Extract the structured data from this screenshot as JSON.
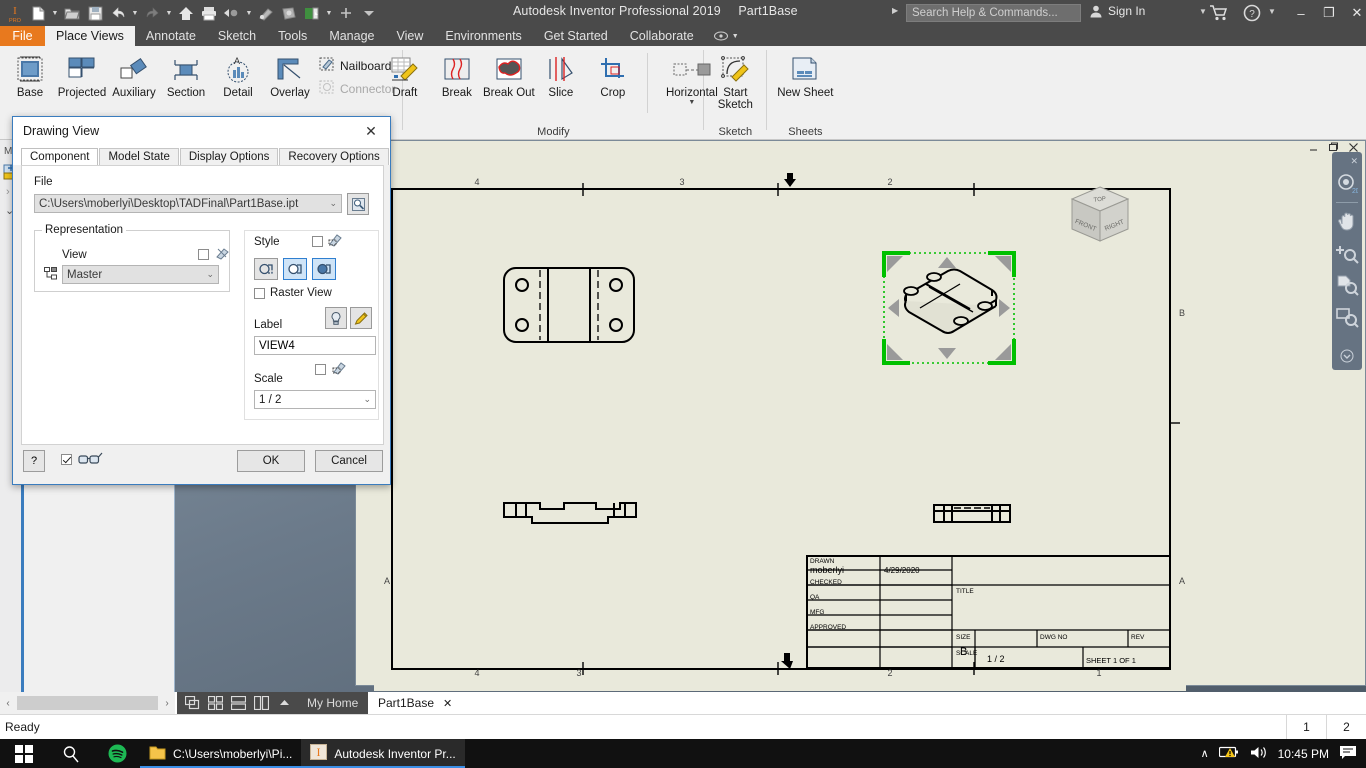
{
  "titlebar": {
    "app_title": "Autodesk Inventor Professional 2019",
    "document": "Part1Base",
    "search_placeholder": "Search Help & Commands...",
    "signin_label": "Sign In",
    "minimize": "–",
    "restore": "❐",
    "close": "✕",
    "quick_access": [
      {
        "name": "inventor-logo-icon",
        "label": "I"
      },
      {
        "name": "new-file-icon",
        "label": "New"
      },
      {
        "name": "open-file-icon",
        "label": "Open"
      },
      {
        "name": "save-icon",
        "label": "Save"
      },
      {
        "name": "undo-icon",
        "label": "Undo"
      },
      {
        "name": "redo-icon",
        "label": "Redo"
      },
      {
        "name": "home-icon",
        "label": "Home"
      },
      {
        "name": "print-icon",
        "label": "Print"
      },
      {
        "name": "select-icon",
        "label": "Select"
      },
      {
        "name": "appearance-icon",
        "label": "Appearance"
      },
      {
        "name": "material-icon",
        "label": "Material"
      },
      {
        "name": "project-icon",
        "label": "Project"
      },
      {
        "name": "add-icon",
        "label": "Add"
      },
      {
        "name": "customize-icon",
        "label": "Customize"
      }
    ]
  },
  "ribbon": {
    "file_tab": "File",
    "tabs": [
      {
        "label": "Place Views",
        "active": true
      },
      {
        "label": "Annotate",
        "active": false
      },
      {
        "label": "Sketch",
        "active": false
      },
      {
        "label": "Tools",
        "active": false
      },
      {
        "label": "Manage",
        "active": false
      },
      {
        "label": "View",
        "active": false
      },
      {
        "label": "Environments",
        "active": false
      },
      {
        "label": "Get Started",
        "active": false
      },
      {
        "label": "Collaborate",
        "active": false
      }
    ],
    "panels": [
      {
        "title": "",
        "buttons": [
          {
            "label": "Base",
            "icon": "base-view-icon"
          },
          {
            "label": "Projected",
            "icon": "projected-view-icon"
          },
          {
            "label": "Auxiliary",
            "icon": "auxiliary-view-icon"
          },
          {
            "label": "Section",
            "icon": "section-view-icon"
          },
          {
            "label": "Detail",
            "icon": "detail-view-icon"
          },
          {
            "label": "Overlay",
            "icon": "overlay-view-icon"
          }
        ],
        "small_buttons": [
          {
            "label": "Nailboard",
            "icon": "nailboard-icon",
            "disabled": false
          },
          {
            "label": "Connector",
            "icon": "connector-icon",
            "disabled": true
          }
        ]
      },
      {
        "title": "Modify",
        "buttons": [
          {
            "label": "Draft",
            "icon": "draft-icon"
          },
          {
            "label": "Break",
            "icon": "break-icon"
          },
          {
            "label": "Break Out",
            "icon": "break-out-icon"
          },
          {
            "label": "Slice",
            "icon": "slice-icon"
          },
          {
            "label": "Crop",
            "icon": "crop-icon"
          },
          {
            "label": "Horizontal",
            "icon": "horizontal-icon",
            "has_dropdown": true
          }
        ]
      },
      {
        "title": "Sketch",
        "buttons": [
          {
            "label": "Start Sketch",
            "icon": "start-sketch-icon"
          }
        ]
      },
      {
        "title": "Sheets",
        "buttons": [
          {
            "label": "New Sheet",
            "icon": "new-sheet-icon"
          }
        ]
      }
    ]
  },
  "dialog": {
    "title": "Drawing View",
    "close_label": "✕",
    "tabs": [
      {
        "label": "Component",
        "active": true
      },
      {
        "label": "Model State",
        "active": false
      },
      {
        "label": "Display Options",
        "active": false
      },
      {
        "label": "Recovery Options",
        "active": false
      }
    ],
    "file": {
      "label": "File",
      "value": "C:\\Users\\moberlyi\\Desktop\\TADFinal\\Part1Base.ipt",
      "browse_icon": "browse-file-icon"
    },
    "representation": {
      "group_label": "Representation",
      "view_label": "View",
      "view_value": "Master",
      "associative_checked": false
    },
    "style": {
      "label": "Style",
      "associative_checked": false,
      "buttons": [
        {
          "name": "hidden-line-style-button",
          "selected": false
        },
        {
          "name": "hidden-line-removed-style-button",
          "selected": true
        },
        {
          "name": "shaded-style-button",
          "selected": true
        }
      ],
      "raster_view_label": "Raster View",
      "raster_view_checked": false
    },
    "label_field": {
      "label": "Label",
      "value": "VIEW4",
      "toggle_icon": "label-visibility-icon",
      "edit_icon": "edit-label-icon"
    },
    "scale_field": {
      "label": "Scale",
      "value": "1 / 2",
      "associative_checked": false
    },
    "footer": {
      "help_label": "?",
      "preview_checked": true,
      "preview_icon": "glasses-preview-icon",
      "ok_label": "OK",
      "cancel_label": "Cancel"
    }
  },
  "drawing": {
    "view_cube": {
      "top": "TOP",
      "front": "FRONT",
      "right": "RIGHT"
    },
    "border_zones_top": [
      "4",
      "3",
      "2"
    ],
    "border_zones_bottom": [
      "4",
      "3",
      "2",
      "1"
    ],
    "border_zones_right": [
      "B",
      "A"
    ],
    "title_block": {
      "rows": [
        {
          "label": "DRAWN",
          "name": "moberlyi",
          "date": "4/29/2020"
        },
        {
          "label": "CHECKED",
          "name": "",
          "date": ""
        },
        {
          "label": "QA",
          "name": "",
          "date": ""
        },
        {
          "label": "MFG",
          "name": "",
          "date": ""
        },
        {
          "label": "APPROVED",
          "name": "",
          "date": ""
        }
      ],
      "title_label": "TITLE",
      "title_value": "",
      "size_label": "SIZE",
      "size_value": "B",
      "dwg_no_label": "DWG NO",
      "dwg_no_value": "",
      "rev_label": "REV",
      "rev_value": "",
      "scale_label": "SCALE",
      "scale_value": "1 / 2",
      "sheet_label": "SHEET 1  OF 1"
    }
  },
  "bottom": {
    "doc_tabs": [
      {
        "label": "My Home",
        "active": false,
        "closable": false
      },
      {
        "label": "Part1Base",
        "active": true,
        "closable": true
      }
    ],
    "close_glyph": "✕",
    "view_buttons": [
      {
        "name": "cascade-windows-icon"
      },
      {
        "name": "tile-windows-icon"
      },
      {
        "name": "tile-horizontal-icon"
      },
      {
        "name": "tile-vertical-icon"
      },
      {
        "name": "expand-tabs-icon"
      }
    ],
    "status_text": "Ready",
    "status_cells": [
      "1",
      "2"
    ]
  },
  "taskbar": {
    "start_icon": "windows-start-icon",
    "search_icon": "search-icon",
    "spotify_icon": "spotify-icon",
    "apps": [
      {
        "label": "C:\\Users\\moberlyi\\Pi...",
        "icon": "folder-icon",
        "running": false
      },
      {
        "label": "Autodesk Inventor Pr...",
        "icon": "inventor-icon",
        "running": true
      }
    ],
    "tray": {
      "chevron": "∧",
      "battery_icon": "battery-warning-icon",
      "volume_icon": "volume-icon",
      "clock": "10:45 PM",
      "notifications_icon": "notifications-icon"
    }
  },
  "colors": {
    "accent_orange": "#e8791e",
    "sheet_bg": "#e9e9db",
    "selection_green": "#00c000",
    "ribbon_bg": "#f0f0f0",
    "titlebar_bg": "#4a4a4a"
  }
}
